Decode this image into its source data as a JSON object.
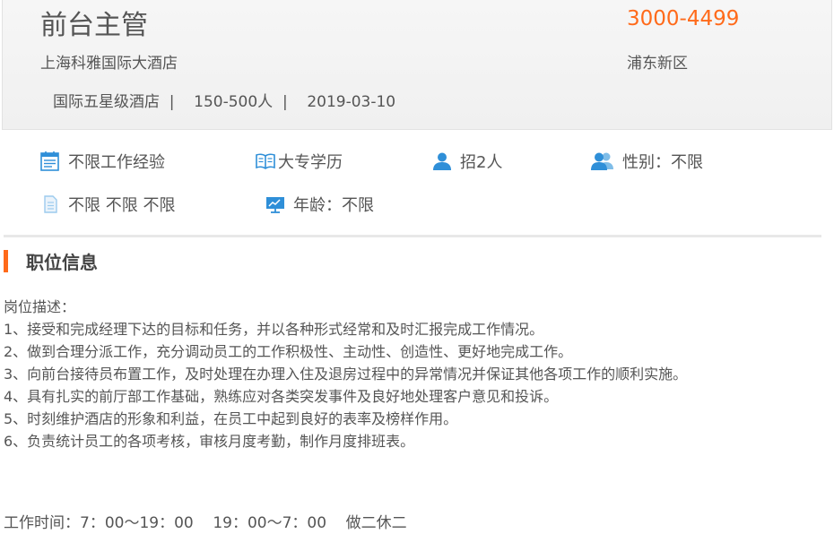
{
  "header": {
    "title": "前台主管",
    "salary": "3000-4499",
    "company": "上海科雅国际大酒店",
    "district": "浦东新区",
    "meta": "国际五星级酒店  |    150-500人  |    2019-03-10"
  },
  "features": {
    "experience": {
      "icon": "calendar-list-icon",
      "label": "不限工作经验"
    },
    "education": {
      "icon": "open-book-icon",
      "label": "大专学历"
    },
    "headcount": {
      "icon": "person-icon",
      "label": "招2人"
    },
    "gender": {
      "icon": "people-icon",
      "label": "性别：不限"
    },
    "languages": {
      "icon": "document-icon",
      "label": "不限 不限 不限"
    },
    "age": {
      "icon": "presentation-board-icon",
      "label": "年龄：不限"
    }
  },
  "section": {
    "title": "职位信息"
  },
  "description": {
    "heading": "岗位描述：",
    "items": [
      "1、接受和完成经理下达的目标和任务，并以各种形式经常和及时汇报完成工作情况。",
      "2、做到合理分派工作，充分调动员工的工作积极性、主动性、创造性、更好地完成工作。",
      "3、向前台接待员布置工作，及时处理在办理入住及退房过程中的异常情况并保证其他各项工作的顺利实施。",
      "4、具有扎实的前厅部工作基础，熟练应对各类突发事件及良好地处理客户意见和投诉。",
      "5、时刻维护酒店的形象和利益，在员工中起到良好的表率及榜样作用。",
      "6、负责统计员工的各项考核，审核月度考勤，制作月度排班表。"
    ]
  },
  "work_time": "工作时间：7：00～19：00    19：00～7：00    做二休二",
  "colors": {
    "accent": "#ff6a1a",
    "icon_blue": "#2f8fd8"
  }
}
